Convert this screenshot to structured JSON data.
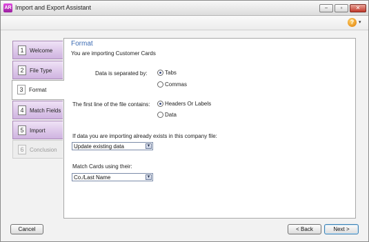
{
  "window": {
    "title": "Import and Export Assistant",
    "app_icon_text": "AR",
    "controls": {
      "minimize": "−",
      "maximize": "▫",
      "close": "✕"
    }
  },
  "toolbar": {
    "help_icon": "?",
    "help_caret": "▾"
  },
  "steps": [
    {
      "num": "1",
      "label": "Welcome"
    },
    {
      "num": "2",
      "label": "File Type"
    },
    {
      "num": "3",
      "label": "Format"
    },
    {
      "num": "4",
      "label": "Match Fields"
    },
    {
      "num": "5",
      "label": "Import"
    },
    {
      "num": "6",
      "label": "Conclusion"
    }
  ],
  "panel": {
    "heading": "Format",
    "subheading": "You are importing Customer Cards",
    "separator": {
      "label": "Data is separated by:",
      "options": [
        "Tabs",
        "Commas"
      ],
      "selected": "Tabs"
    },
    "first_line": {
      "label": "The first line of the file contains:",
      "options": [
        "Headers Or Labels",
        "Data"
      ],
      "selected": "Headers Or Labels"
    },
    "existing": {
      "label": "If data you are importing already exists in this company file:",
      "value": "Update existing data"
    },
    "match": {
      "label": "Match Cards using their:",
      "value": "Co./Last Name"
    }
  },
  "buttons": {
    "cancel": "Cancel",
    "back": "< Back",
    "next": "Next >"
  },
  "colors": {
    "heading": "#3b6bb3",
    "step_bg": "#cfb3e0",
    "window_bg": "#f2f2f2"
  }
}
